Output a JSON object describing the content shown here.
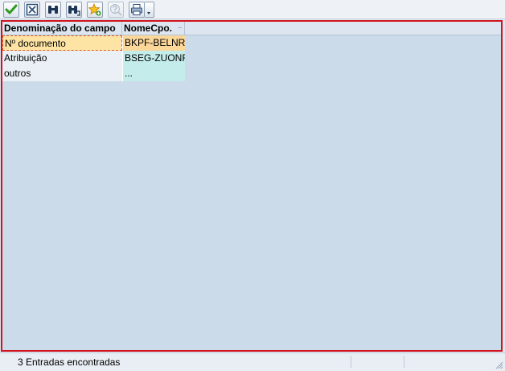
{
  "toolbar": {
    "buttons": [
      {
        "icon": "checkmark-icon",
        "name": "confirm-button"
      },
      {
        "icon": "cancel-icon",
        "name": "cancel-button"
      },
      {
        "icon": "binoculars-icon",
        "name": "find-button"
      },
      {
        "icon": "find-next-icon",
        "name": "find-next-button"
      },
      {
        "icon": "favorites-star-icon",
        "name": "favorites-button"
      },
      {
        "icon": "help-icon",
        "name": "help-button",
        "disabled": true
      },
      {
        "icon": "printer-icon",
        "name": "print-button"
      }
    ]
  },
  "table": {
    "columns": [
      "Denominação do campo",
      "NomeCpo."
    ],
    "rows": [
      {
        "label": "Nº documento",
        "field": "BKPF-BELNR",
        "selected": true
      },
      {
        "label": "Atribuição",
        "field": "BSEG-ZUONR",
        "selected": false
      },
      {
        "label": "outros",
        "field": "...",
        "selected": false
      }
    ]
  },
  "status": {
    "message": "3 Entradas encontradas"
  },
  "colors": {
    "highlight_border": "#d0141d",
    "selected_row": "#fde4a4",
    "field_cell": "#c3ecea",
    "background": "#ccdbe9"
  }
}
